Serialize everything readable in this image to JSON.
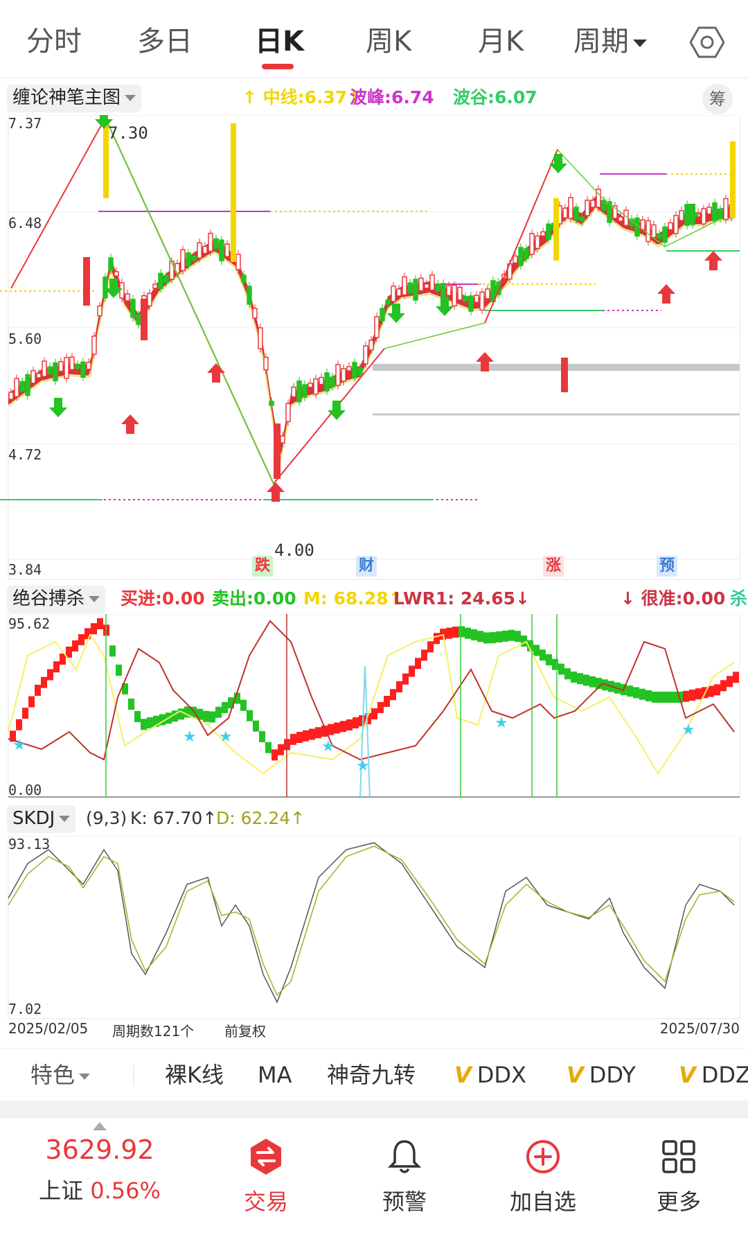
{
  "tabs": [
    {
      "label": "分时"
    },
    {
      "label": "多日"
    },
    {
      "label": "日K"
    },
    {
      "label": "周K"
    },
    {
      "label": "月K"
    },
    {
      "label": "周期"
    }
  ],
  "main": {
    "selector": "缠论神笔主图",
    "indicators": [
      {
        "text": "↑ 中线:6.37↑",
        "color": "#f2d600"
      },
      {
        "text": "波峰:6.74",
        "color": "#cc33cc"
      },
      {
        "text": "波谷:6.07",
        "color": "#33cc66"
      }
    ],
    "chou_btn": "筹",
    "y_max": "7.37",
    "y_2": "6.48",
    "y_3": "5.60",
    "y_4": "4.72",
    "y_min": "3.84",
    "peak_label": "7.30",
    "trough_label": "4.00",
    "events": [
      {
        "text": "跌"
      },
      {
        "text": "财"
      },
      {
        "text": "涨"
      },
      {
        "text": "预"
      }
    ]
  },
  "mid": {
    "selector": "绝谷搏杀",
    "i1": "买进:0.00",
    "i2": "卖出:0.00",
    "i3": "M: 68.28↑",
    "i4": "LWR1: 24.65↓",
    "i5": "↓ 很准:0.00",
    "tail": "杀",
    "y_max": "95.62",
    "y_min": "0.00"
  },
  "skdj": {
    "selector": "SKDJ",
    "param": "(9,3)",
    "k": "K: 67.70↑",
    "d": "D: 62.24↑",
    "y_max": "93.13",
    "y_min": "7.02"
  },
  "footer": {
    "start_date": "2025/02/05",
    "period_count": "周期数121个",
    "adjust": "前复权",
    "end_date": "2025/07/30"
  },
  "toolbar": {
    "tese": "特色",
    "items": [
      "裸K线",
      "MA",
      "神奇九转"
    ],
    "v_items": [
      "DDX",
      "DDY",
      "DDZ"
    ]
  },
  "bottom": {
    "index_value": "3629.92",
    "index_name": "上证",
    "index_change": "0.56%",
    "trade": "交易",
    "alert": "预警",
    "add": "加自选",
    "more": "更多"
  },
  "colors": {
    "up": "#e8383c",
    "down": "#22c322",
    "accent": "#e8383c",
    "yellow": "#f2d600",
    "magenta": "#cc33cc"
  }
}
